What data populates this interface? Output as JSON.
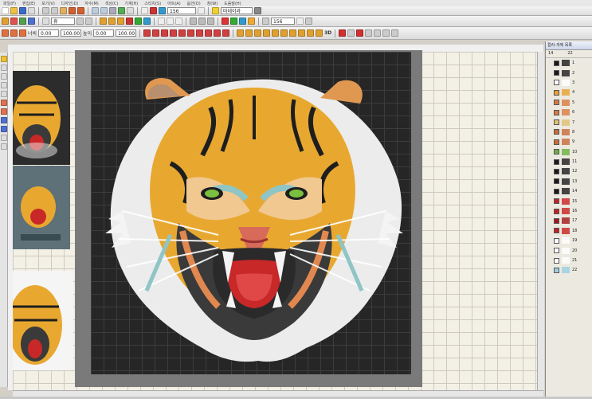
{
  "menubar": {
    "items": [
      "파일(F)",
      "편집(E)",
      "보기(V)",
      "디자인(D)",
      "자수(M)",
      "색상(C)",
      "기계(H)",
      "스티치(S)",
      "아트(A)",
      "옵션(O)",
      "창(W)",
      "도움말(H)"
    ]
  },
  "toolbar": {
    "zoom_value": "156",
    "font_value": "휴",
    "thread_label": "마데이라",
    "letter_spacing_value": "0.00",
    "line_spacing_value": "0.00",
    "width_pct": "100.00",
    "height_pct": "100.00",
    "row1_labels": [
      "너비",
      "높이"
    ],
    "style_label": "3D",
    "density_value": "156",
    "stitch_value": "156"
  },
  "canvas": {
    "background": "#f3f0e6",
    "design_background": "#262626"
  },
  "color_panel": {
    "title": "컬러-개체 목록",
    "col_a": "14",
    "col_b": "22",
    "rows": [
      {
        "num": "1",
        "color": "#1a1a1a"
      },
      {
        "num": "2",
        "color": "#1a1a1a"
      },
      {
        "num": "3",
        "color": "#ffffff"
      },
      {
        "num": "4",
        "color": "#e8a030"
      },
      {
        "num": "5",
        "color": "#d87a40"
      },
      {
        "num": "6",
        "color": "#d87a40"
      },
      {
        "num": "7",
        "color": "#e0c070"
      },
      {
        "num": "8",
        "color": "#c86a3a"
      },
      {
        "num": "9",
        "color": "#c86a3a"
      },
      {
        "num": "10",
        "color": "#6ab040"
      },
      {
        "num": "11",
        "color": "#1a1a1a"
      },
      {
        "num": "12",
        "color": "#1a1a1a"
      },
      {
        "num": "13",
        "color": "#1a1a1a"
      },
      {
        "num": "14",
        "color": "#1a1a1a"
      },
      {
        "num": "15",
        "color": "#c82020"
      },
      {
        "num": "16",
        "color": "#c82020"
      },
      {
        "num": "17",
        "color": "#a01818"
      },
      {
        "num": "18",
        "color": "#c82020"
      },
      {
        "num": "19",
        "color": "#ffffff"
      },
      {
        "num": "20",
        "color": "#ffffff"
      },
      {
        "num": "21",
        "color": "#ffffff"
      },
      {
        "num": "22",
        "color": "#9ad0e0"
      }
    ]
  }
}
